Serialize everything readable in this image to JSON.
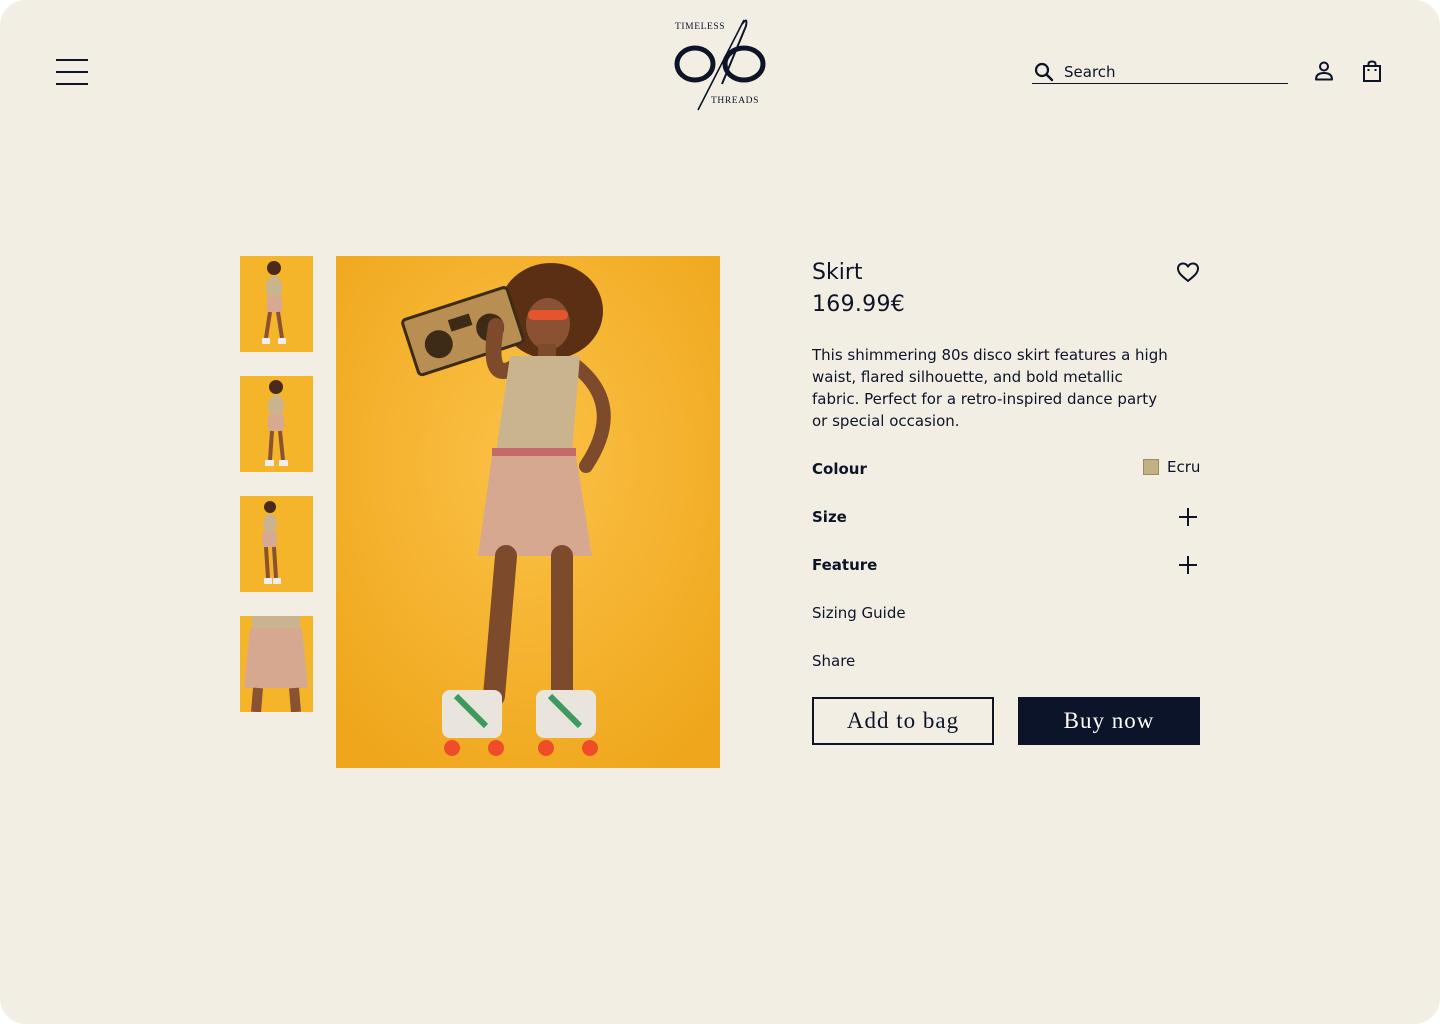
{
  "header": {
    "logo": {
      "top_text": "TIMELESS",
      "bottom_text": "THREADS"
    },
    "search": {
      "placeholder": "Search"
    },
    "icons": [
      "menu-icon",
      "search-icon",
      "account-icon",
      "shopping-bag-icon"
    ]
  },
  "gallery": {
    "thumbnails": [
      "full-body-pose-1",
      "full-body-pose-2",
      "full-body-pose-3",
      "skirt-detail"
    ],
    "main_image": "model-with-boombox-roller-skates",
    "background_color": "#f5b52a"
  },
  "product": {
    "name": "Skirt",
    "price": "169.99€",
    "description": "This shimmering 80s disco skirt features a high waist, flared silhouette, and bold metallic fabric. Perfect for a retro-inspired dance party or special occasion.",
    "colour": {
      "label": "Colour",
      "value": "Ecru",
      "swatch": "#c2b183"
    },
    "size_label": "Size",
    "feature_label": "Feature",
    "sizing_guide": "Sizing Guide",
    "share": "Share"
  },
  "actions": {
    "add_to_bag": "Add to bag",
    "buy_now": "Buy now"
  },
  "colors": {
    "background": "#f3eee4",
    "primary": "#0b1428",
    "accent_yellow": "#f5b52a"
  }
}
